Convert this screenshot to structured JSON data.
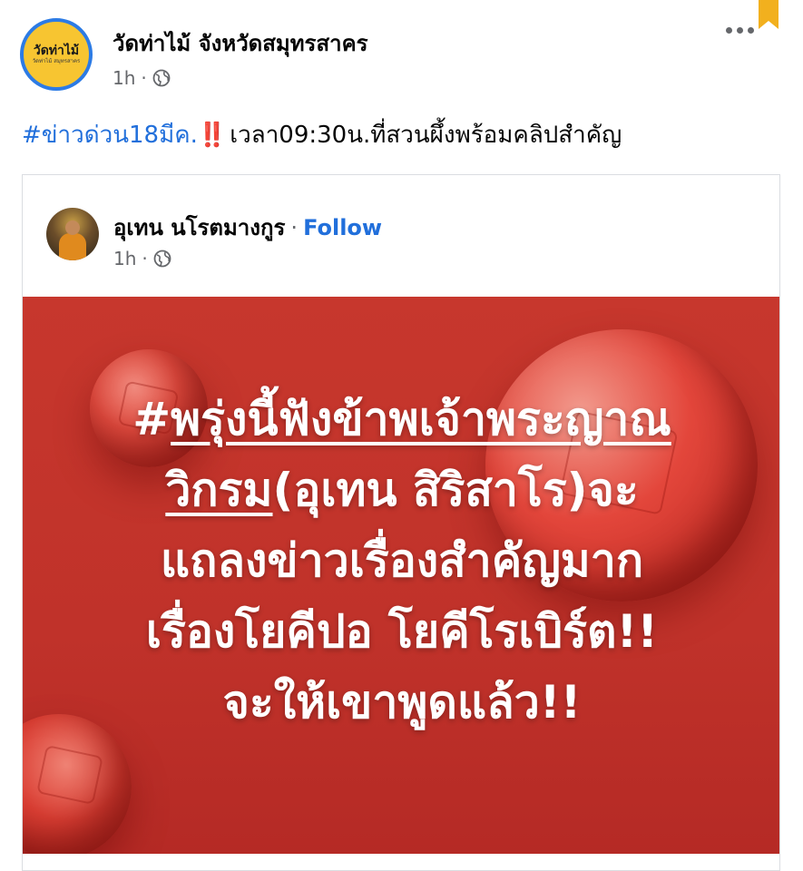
{
  "post": {
    "avatar_logo_text": "วัดท่าไม้",
    "avatar_logo_sub": "วัดท่าไม้ สมุทรสาคร",
    "page_name": "วัดท่าไม้ จังหวัดสมุทรสาคร",
    "time": "1h",
    "separator": "·",
    "caption_hashtag": "#ข่าวด่วน18มีค.",
    "caption_alert": "‼️",
    "caption_text": "เวลา09:30น.ที่สวนผึ้งพร้อมคลิปสำคัญ"
  },
  "shared": {
    "author_name": "อุเทน นโรตมางกูร",
    "separator": "·",
    "follow_label": "Follow",
    "time": "1h",
    "image_text": {
      "hashtag_part": "#",
      "underlined_1": "พรุ่งนี้ฟังข้าพเจ้าพระญาณ",
      "underlined_2": "วิกรม",
      "line2_rest": "(อุเทน สิริสาโร)จะ",
      "line3": "แถลงข่าวเรื่องสำคัญมาก",
      "line4": "เรื่องโยคีปอ โยคีโรเบิร์ต!!",
      "line5": "จะให้เขาพูดแล้ว!!"
    }
  },
  "colors": {
    "link_blue": "#216fdb",
    "image_red": "#c7372d",
    "logo_yellow": "#f7c531",
    "bookmark": "#f2b01e"
  },
  "icons": [
    "globe-icon",
    "more-options-icon",
    "bookmark-icon"
  ]
}
